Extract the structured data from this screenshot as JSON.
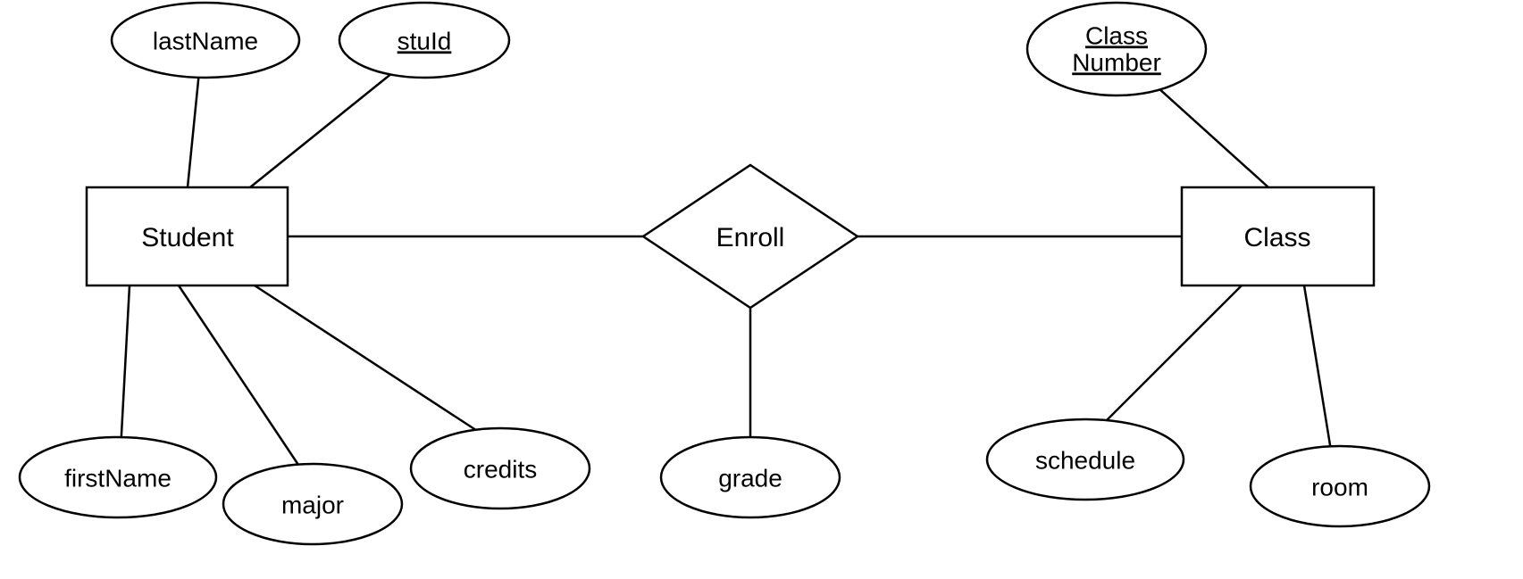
{
  "entities": {
    "student": {
      "label": "Student"
    },
    "class": {
      "label": "Class"
    }
  },
  "relationships": {
    "enroll": {
      "label": "Enroll"
    }
  },
  "attributes": {
    "lastName": {
      "label": "lastName",
      "key": false
    },
    "stuId": {
      "label": "stuId",
      "key": true
    },
    "firstName": {
      "label": "firstName",
      "key": false
    },
    "major": {
      "label": "major",
      "key": false
    },
    "credits": {
      "label": "credits",
      "key": false
    },
    "grade": {
      "label": "grade",
      "key": false
    },
    "classNumber": {
      "label1": "Class",
      "label2": "Number",
      "key": true
    },
    "schedule": {
      "label": "schedule",
      "key": false
    },
    "room": {
      "label": "room",
      "key": false
    }
  }
}
